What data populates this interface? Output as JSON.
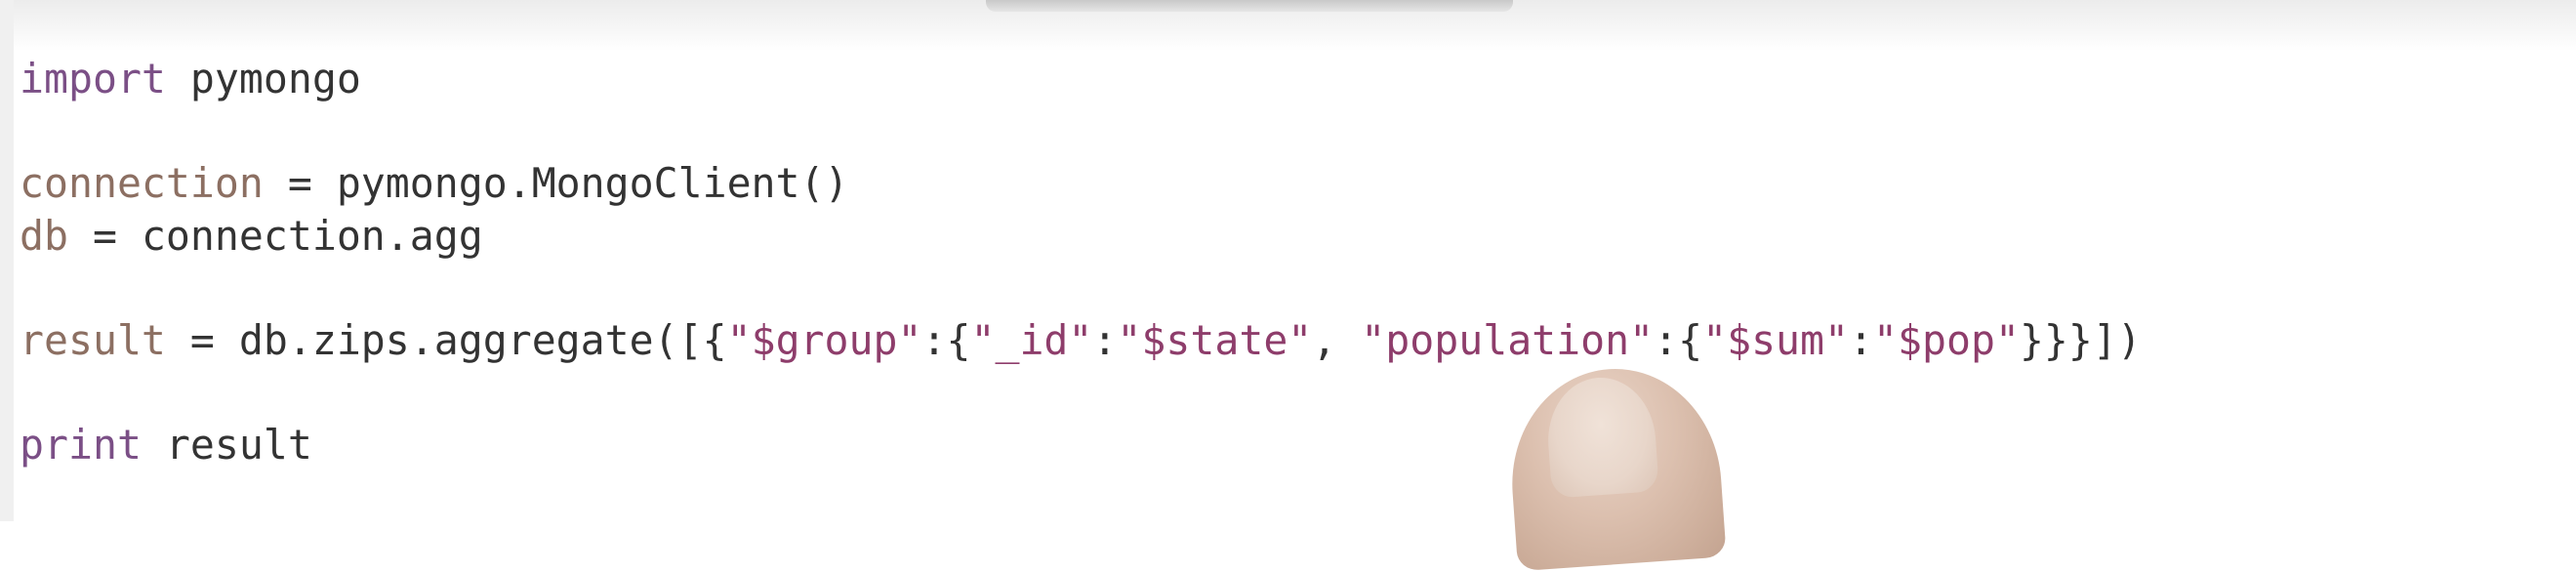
{
  "editor": {
    "lines": [
      [
        {
          "text": "import",
          "type": "keyword"
        },
        {
          "text": " pymongo",
          "type": "plain"
        }
      ],
      [],
      [
        {
          "text": "connection",
          "type": "var"
        },
        {
          "text": " = pymongo.MongoClient()",
          "type": "plain"
        }
      ],
      [
        {
          "text": "db",
          "type": "var"
        },
        {
          "text": " = connection.agg",
          "type": "plain"
        }
      ],
      [],
      [
        {
          "text": "result",
          "type": "var"
        },
        {
          "text": " = db.zips.aggregate([{",
          "type": "plain"
        },
        {
          "text": "\"$group\"",
          "type": "string"
        },
        {
          "text": ":{",
          "type": "plain"
        },
        {
          "text": "\"_id\"",
          "type": "string"
        },
        {
          "text": ":",
          "type": "plain"
        },
        {
          "text": "\"$state\"",
          "type": "string"
        },
        {
          "text": ", ",
          "type": "plain"
        },
        {
          "text": "\"population\"",
          "type": "string"
        },
        {
          "text": ":{",
          "type": "plain"
        },
        {
          "text": "\"$sum\"",
          "type": "string"
        },
        {
          "text": ":",
          "type": "plain"
        },
        {
          "text": "\"$pop\"",
          "type": "string"
        },
        {
          "text": "}}}])",
          "type": "plain"
        }
      ],
      [],
      [
        {
          "text": "print",
          "type": "keyword"
        },
        {
          "text": " result",
          "type": "plain"
        }
      ]
    ]
  },
  "colors": {
    "keyword": "#7b4f86",
    "variable": "#8c6f62",
    "string": "#8e3d6b",
    "text": "#333333"
  }
}
